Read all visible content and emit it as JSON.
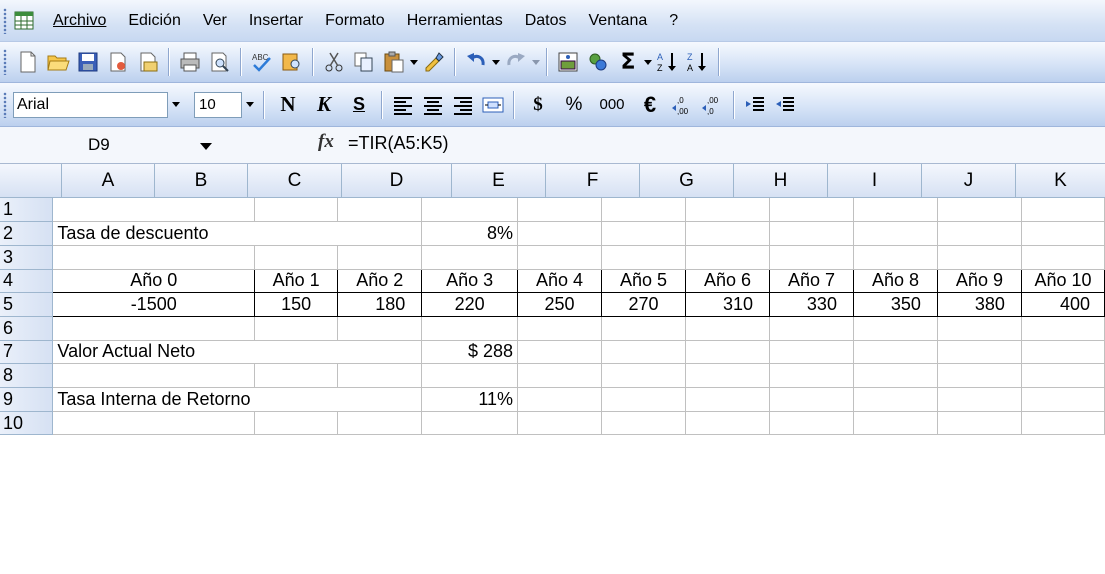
{
  "menu": [
    "Archivo",
    "Edición",
    "Ver",
    "Insertar",
    "Formato",
    "Herramientas",
    "Datos",
    "Ventana",
    "?"
  ],
  "toolbar_standard": {
    "icons": [
      "new-document-icon",
      "open-folder-icon",
      "save-icon",
      "permission-icon",
      "email-icon",
      "print-icon",
      "print-preview-icon",
      "spelling-icon",
      "research-icon",
      "cut-icon",
      "copy-icon",
      "paste-icon",
      "format-painter-icon",
      "undo-icon",
      "redo-icon",
      "insert-hyperlink-icon",
      "sum-icon",
      "sort-ascending-icon",
      "sort-descending-icon"
    ],
    "sum_label": "Σ"
  },
  "toolbar_format": {
    "font": "Arial",
    "size": "10",
    "bold": "N",
    "italic": "K",
    "underline": "S",
    "currency": "$",
    "percent": "%",
    "thousands": "000",
    "euro": "€",
    "colors": {
      "bar_gradient_top": "#f6f9fe",
      "bar_gradient_bottom": "#bcd0ee"
    }
  },
  "formula_bar": {
    "name_box": "D9",
    "fx": "fx",
    "formula": "=TIR(A5:K5)"
  },
  "sheet": {
    "columns": [
      "A",
      "B",
      "C",
      "D",
      "E",
      "F",
      "G",
      "H",
      "I",
      "J",
      "K"
    ],
    "rows": [
      "1",
      "2",
      "3",
      "4",
      "5",
      "6",
      "7",
      "8",
      "9",
      "10"
    ],
    "cells": {
      "r2": {
        "a": "Tasa de descuento",
        "d": "8%"
      },
      "r4": [
        "Año 0",
        "Año 1",
        "Año 2",
        "Año 3",
        "Año 4",
        "Año 5",
        "Año 6",
        "Año 7",
        "Año 8",
        "Año 9",
        "Año 10"
      ],
      "r5": [
        "-1500",
        "150",
        "180",
        "220",
        "250",
        "270",
        "310",
        "330",
        "350",
        "380",
        "400"
      ],
      "r7": {
        "a": "Valor Actual Neto",
        "d": "$ 288"
      },
      "r9": {
        "a": "Tasa Interna de Retorno",
        "d": "11%"
      }
    }
  }
}
